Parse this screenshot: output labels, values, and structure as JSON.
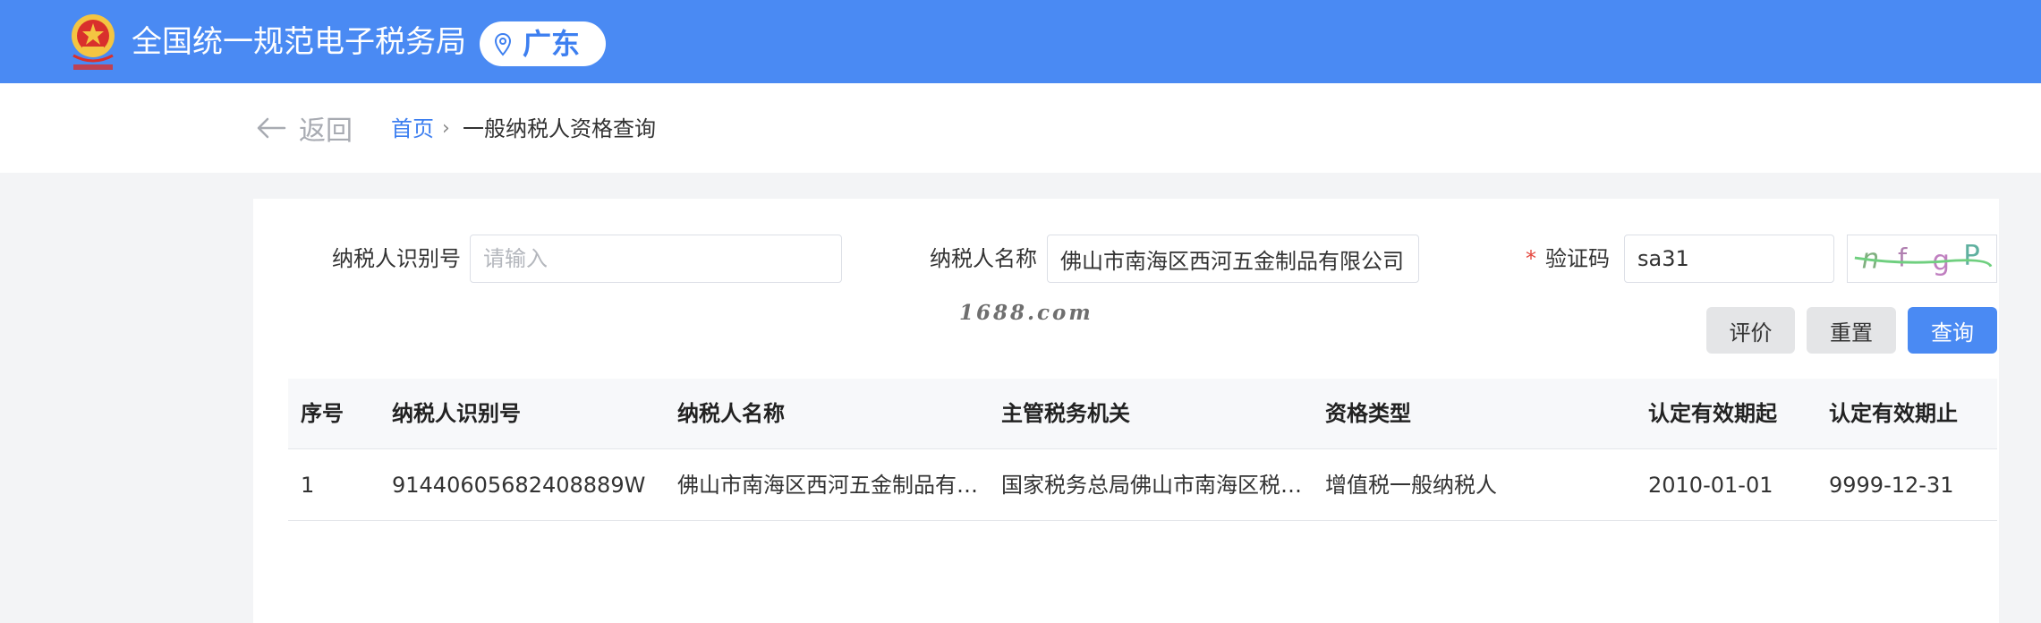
{
  "header": {
    "title": "全国统一规范电子税务局",
    "region": "广东"
  },
  "nav": {
    "back_label": "返回",
    "breadcrumb_home": "首页",
    "breadcrumb_sep": "›",
    "breadcrumb_current": "一般纳税人资格查询"
  },
  "form": {
    "taxpayer_id_label": "纳税人识别号",
    "taxpayer_id_placeholder": "请输入",
    "taxpayer_id_value": "",
    "taxpayer_name_label": "纳税人名称",
    "taxpayer_name_value": "佛山市南海区西河五金制品有限公司",
    "captcha_required_mark": "*",
    "captcha_label": "验证码",
    "captcha_value": "sa31",
    "captcha_image_text": "nfgP"
  },
  "watermark": "1688.com",
  "buttons": {
    "evaluate": "评价",
    "reset": "重置",
    "query": "查询"
  },
  "table": {
    "headers": [
      "序号",
      "纳税人识别号",
      "纳税人名称",
      "主管税务机关",
      "资格类型",
      "认定有效期起",
      "认定有效期止"
    ],
    "rows": [
      [
        "1",
        "91440605682408889W",
        "佛山市南海区西河五金制品有限公司",
        "国家税务总局佛山市南海区税务局",
        "增值税一般纳税人",
        "2010-01-01",
        "9999-12-31"
      ]
    ]
  },
  "colors": {
    "header_bg": "#4a8af3",
    "accent": "#3d7ff0",
    "required": "#e4463d"
  }
}
